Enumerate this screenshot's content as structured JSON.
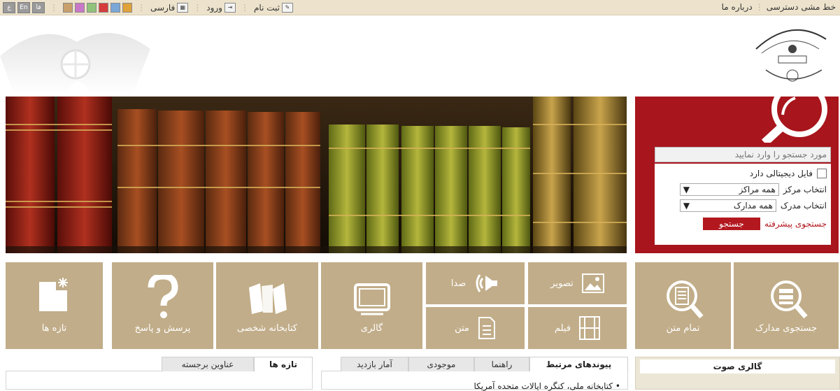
{
  "topbar": {
    "policy": "خط مشی دسترسی",
    "about": "درباره ما",
    "register": "ثبت نام",
    "login": "ورود",
    "language": "فارسی",
    "lang_buttons": [
      "ع",
      "En",
      "فا"
    ],
    "theme_swatches": [
      "#c9a06b",
      "#c978c9",
      "#8fc37a",
      "#d63b3b",
      "#7aa7d6",
      "#e0a23b"
    ]
  },
  "search": {
    "placeholder": "مورد جستجو را وارد نمایید",
    "digital_label": "فایل دیجیتالی دارد",
    "center_label": "انتخاب مرکز",
    "center_value": "همه مراکز",
    "doc_label": "انتخاب مدرک",
    "doc_value": "همه مدارک",
    "advanced": "جستجوی پیشرفته",
    "button": "جستجو"
  },
  "tiles": {
    "docs_search": "جستجوی مدارک",
    "fulltext": "تمام متن",
    "image": "تصویر",
    "audio": "صدا",
    "film": "فیلم",
    "text": "متن",
    "gallery": "گالری",
    "personal_library": "کتابخانه شخصی",
    "qa": "پرسش و پاسخ",
    "new_items": "تازه ها"
  },
  "bottom": {
    "audio_gallery": "گالری صوت",
    "links_tabs": [
      "پیوندهای مرتبط",
      "راهنما",
      "موجودی",
      "آمار بازدید"
    ],
    "news_tabs": [
      "تازه ها",
      "عناوین برجسته"
    ],
    "first_link": "کتابخانه ملی، کنگره ایالات متحده آمریکا"
  },
  "colors": {
    "topbar": "#ede3cc",
    "accent_red": "#a8151c",
    "tile": "#c1ad89"
  }
}
